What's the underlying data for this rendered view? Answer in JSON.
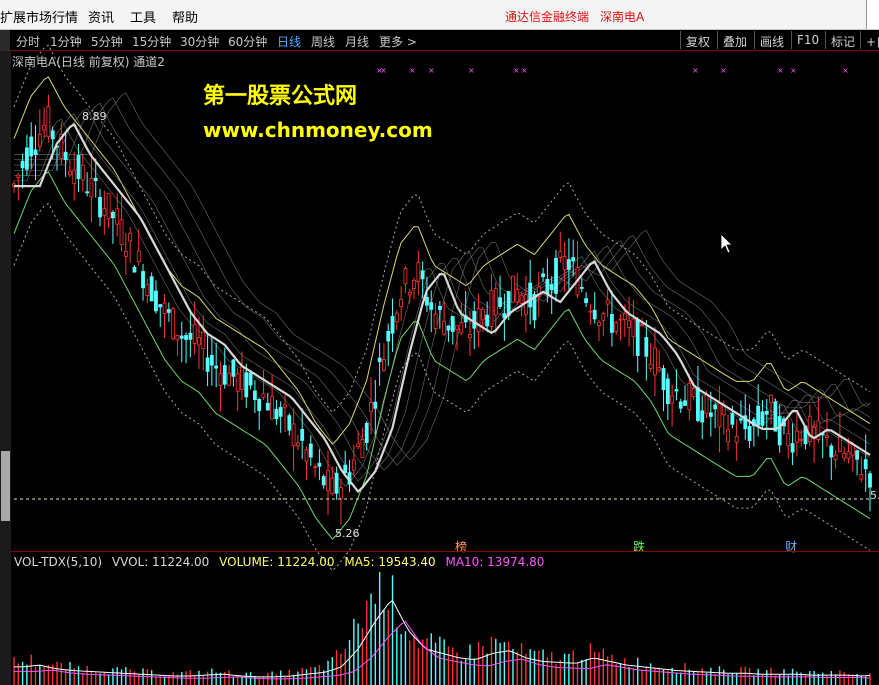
{
  "menu": {
    "items": [
      "扩展市场行情",
      "资讯",
      "工具",
      "帮助"
    ],
    "right_text": "通达信金融终端",
    "right_stock": "深南电A"
  },
  "periods": [
    "分时",
    "1分钟",
    "5分钟",
    "15分钟",
    "30分钟",
    "60分钟",
    "日线",
    "周线",
    "月线",
    "更多 >"
  ],
  "active_period": "日线",
  "right_buttons": [
    "复权",
    "叠加",
    "画线",
    "F10",
    "标记",
    "+自"
  ],
  "chart_title": "深南电A(日线 前复权) 通道2",
  "watermark": {
    "line1": "第一股票公式网",
    "line2": "www.chnmoney.com"
  },
  "price_labels": {
    "high": "8.89",
    "low": "5.26",
    "right": "5."
  },
  "events": [
    "榜",
    "跌",
    "财"
  ],
  "volume_header": {
    "indicator": "VOL-TDX(5,10)",
    "vvol": "VVOL: 11224.00",
    "volume": "VOLUME: 11224.00",
    "ma5": "MA5: 19543.40",
    "ma10": "MA10: 13974.80"
  },
  "colors": {
    "up": "#ff3333",
    "down": "#54ffff",
    "ma_main": "#d8d8d8",
    "band_outer": "#ffff80",
    "band_green": "#80ff80",
    "ma10": "#ff55ff",
    "volume_white": "#ffffff"
  },
  "chart_data": {
    "type": "candlestick",
    "price_path": [
      8.2,
      8.6,
      8.8,
      8.5,
      8.3,
      8.1,
      7.9,
      7.6,
      7.3,
      7.0,
      6.8,
      6.7,
      6.5,
      6.4,
      6.3,
      6.2,
      6.0,
      5.8,
      5.5,
      5.3,
      5.5,
      5.9,
      6.6,
      7.2,
      7.4,
      7.0,
      6.9,
      6.8,
      7.0,
      7.1,
      7.2,
      7.1,
      7.3,
      7.5,
      7.2,
      7.0,
      6.9,
      6.8,
      6.6,
      6.3,
      6.2,
      6.1,
      6.0,
      5.9,
      5.9,
      6.1,
      5.8,
      5.9,
      5.8,
      5.7,
      5.6,
      5.5
    ],
    "volume_path": [
      20,
      22,
      18,
      16,
      15,
      14,
      13,
      12,
      11,
      10,
      10,
      11,
      12,
      10,
      9,
      9,
      10,
      12,
      14,
      20,
      40,
      70,
      95,
      60,
      40,
      35,
      30,
      28,
      35,
      38,
      30,
      26,
      25,
      24,
      30,
      26,
      22,
      20,
      18,
      16,
      15,
      14,
      13,
      13,
      12,
      12,
      12,
      11,
      11,
      11,
      10,
      11
    ]
  }
}
